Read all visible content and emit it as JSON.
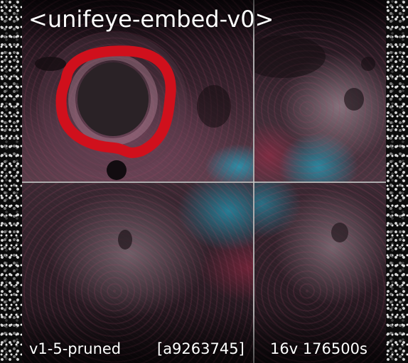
{
  "title": "<unifeye-embed-v0>",
  "footer": {
    "model": "v1-5-pruned",
    "hash": "[a9263745]",
    "stats": "16v 176500s"
  },
  "colors": {
    "annotation_ring": "#d0101c",
    "grid_line": "#c8c8c8",
    "accent_cyan": "#1eaac8",
    "tissue_red": "#8c3c5a"
  },
  "images": [
    "iris-closeup-with-red-ring-image",
    "eye-tissue-top-right-image",
    "eye-tissue-bottom-left-image",
    "eye-tissue-bottom-right-image"
  ]
}
